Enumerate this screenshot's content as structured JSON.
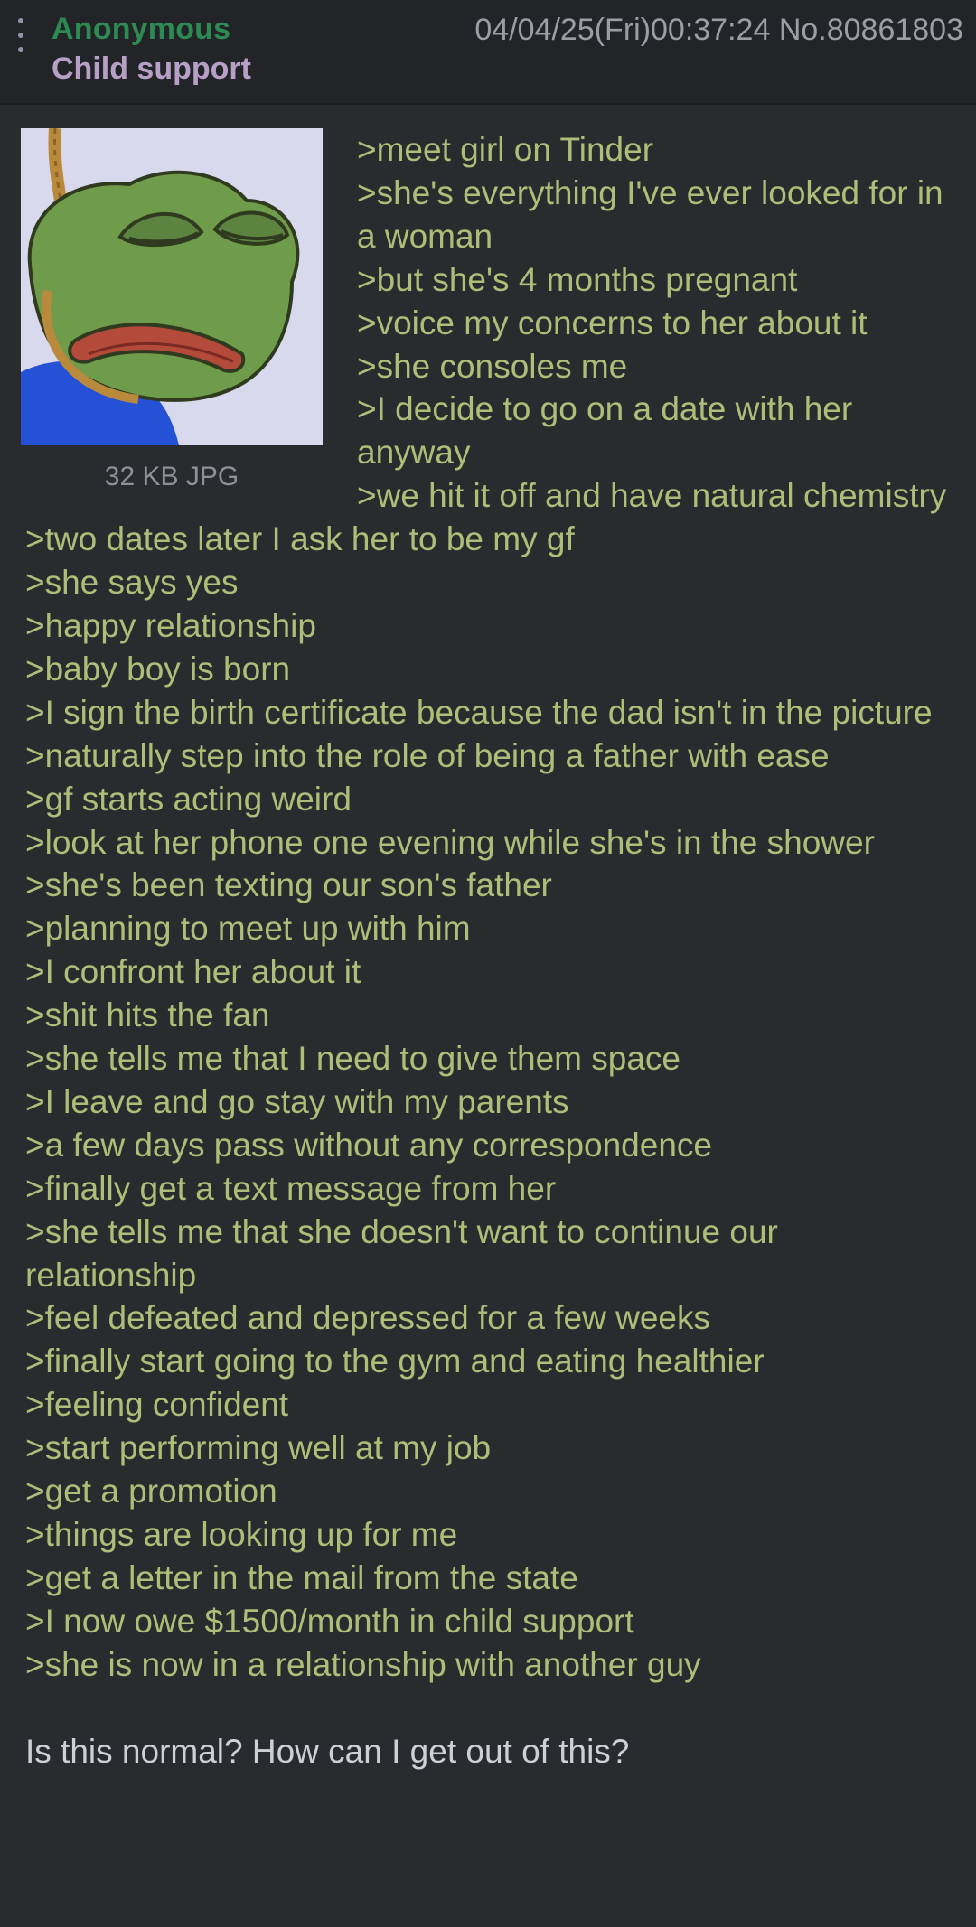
{
  "header": {
    "name": "Anonymous",
    "subject": "Child support",
    "datetime": "04/04/25(Fri)00:37:24",
    "post_number": "No.80861803"
  },
  "file": {
    "info": "32 KB JPG",
    "icon": "sad-frog-noose-thumbnail"
  },
  "lines": [
    ">meet girl on Tinder",
    ">she's everything I've ever looked for in a woman",
    ">but she's 4 months pregnant",
    ">voice my concerns to her about it",
    ">she consoles me",
    ">I decide to go on a date with her anyway",
    ">we hit it off and have natural chemistry",
    ">two dates later I ask her to be my gf",
    ">she says yes",
    ">happy relationship",
    ">baby boy is born",
    ">I sign the birth certificate because the dad isn't in the picture",
    ">naturally step into the role of being a father with ease",
    ">gf starts acting weird",
    ">look at her phone one evening while she's in the shower",
    ">she's been texting our son's father",
    ">planning to meet up with him",
    ">I confront her about it",
    ">shit hits the fan",
    ">she tells me that I need to give them space",
    ">I leave and go stay with my parents",
    ">a few days pass without any correspondence",
    ">finally get a text message from her",
    ">she tells me that she doesn't want to continue our relationship",
    ">feel defeated and depressed for a few weeks",
    ">finally start going to the gym and eating healthier",
    ">feeling confident",
    ">start performing well at my job",
    ">get a promotion",
    ">things are looking up for me",
    ">get a letter in the mail from the state",
    ">I now owe $1500/month in child support",
    ">she is now in a relationship with another guy"
  ],
  "closing": "Is this normal? How can I get out of this?",
  "colors": {
    "background": "#2a2b2f",
    "header_background": "#232428",
    "name": "#2d8a52",
    "subject": "#b6a0c6",
    "greentext": "#aebe78",
    "text": "#cfd0d6",
    "meta": "#9c9ea4"
  }
}
